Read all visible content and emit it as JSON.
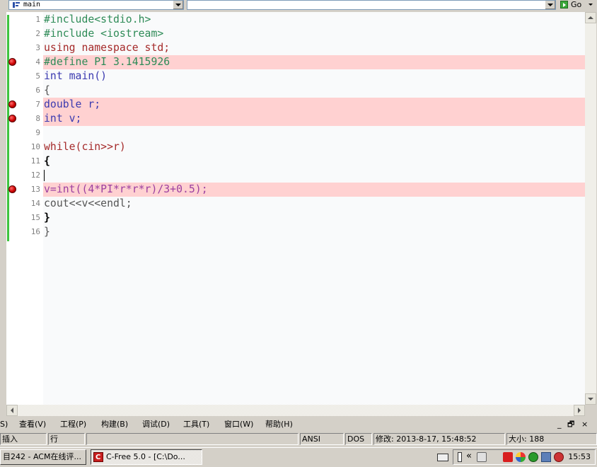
{
  "toolbar": {
    "function_combo": "main",
    "go_label": "Go"
  },
  "editor": {
    "line_numbers": [
      "1",
      "2",
      "3",
      "4",
      "5",
      "6",
      "7",
      "8",
      "9",
      "10",
      "11",
      "12",
      "13",
      "14",
      "15",
      "16"
    ],
    "breakpoint_lines": [
      4,
      7,
      8,
      13
    ],
    "lines": [
      "#include<stdio.h>",
      "#include <iostream>",
      "using namespace std;",
      "#define PI 3.1415926",
      "int main()",
      "{",
      "double r;",
      "int v;",
      "",
      "while(cin>>r)",
      "{",
      "",
      "v=int((4*PI*r*r*r)/3+0.5);",
      "cout<<v<<endl;",
      "}",
      "}"
    ],
    "colors": {
      "breakpoint_highlight": "#ffd1d1",
      "change_marker": "#3fc43f"
    }
  },
  "menu": {
    "items": [
      "S)",
      "查看(V)",
      "工程(P)",
      "构建(B)",
      "调试(D)",
      "工具(T)",
      "窗口(W)",
      "帮助(H)"
    ],
    "window_controls": [
      "_",
      "🗗",
      "×"
    ]
  },
  "status": {
    "mode": "插入",
    "row_label": "行",
    "encoding": "ANSI",
    "line_ending": "DOS",
    "modified": "修改: 2013-8-17, 15:48:52",
    "size": "大小: 188"
  },
  "taskbar": {
    "task1": "目242 - ACM在线评...",
    "task2": "C-Free 5.0 - [C:\\Do...",
    "tray_chevron": "«",
    "clock": "15:53"
  }
}
